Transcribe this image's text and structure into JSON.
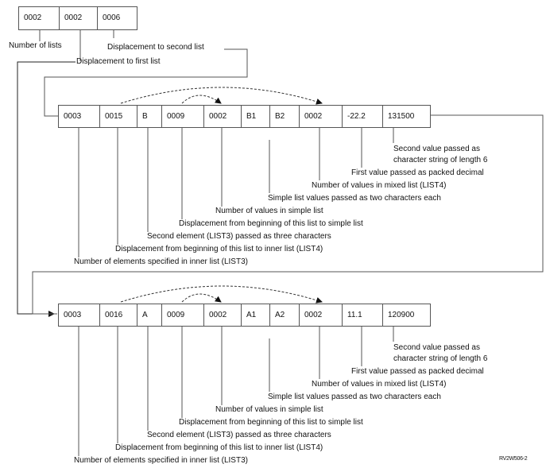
{
  "header": {
    "cells": [
      "0002",
      "0002",
      "0006"
    ],
    "labels": {
      "number_of_lists": "Number of lists",
      "displacement_first": "Displacement to first list",
      "displacement_second": "Displacement to second list"
    }
  },
  "lists": [
    {
      "cells": [
        "0003",
        "0015",
        "B",
        "0009",
        "0002",
        "B1",
        "B2",
        "0002",
        "-22.2",
        "131500"
      ],
      "annotations": [
        "Second value passed as",
        "character string of length 6",
        "First value passed as packed decimal",
        "Number of values in mixed list (LIST4)",
        "Simple list values passed as two characters each",
        "Number of values in simple list",
        "Displacement from beginning of this list to simple list",
        "Second element (LIST3) passed as three characters",
        "Displacement from beginning of this list to inner list (LIST4)",
        "Number of elements specified in inner list (LIST3)"
      ]
    },
    {
      "cells": [
        "0003",
        "0016",
        "A",
        "0009",
        "0002",
        "A1",
        "A2",
        "0002",
        "11.1",
        "120900"
      ],
      "annotations": [
        "Second value passed as",
        "character string of length 6",
        "First value passed as packed decimal",
        "Number of values in mixed list (LIST4)",
        "Simple list values passed as two characters each",
        "Number of values in simple list",
        "Displacement from beginning of this list to simple list",
        "Second element (LIST3) passed as three characters",
        "Displacement from beginning of this list to inner list (LIST4)",
        "Number of elements specified in inner list (LIST3)"
      ]
    }
  ],
  "figure_id": "RV2W506-2"
}
